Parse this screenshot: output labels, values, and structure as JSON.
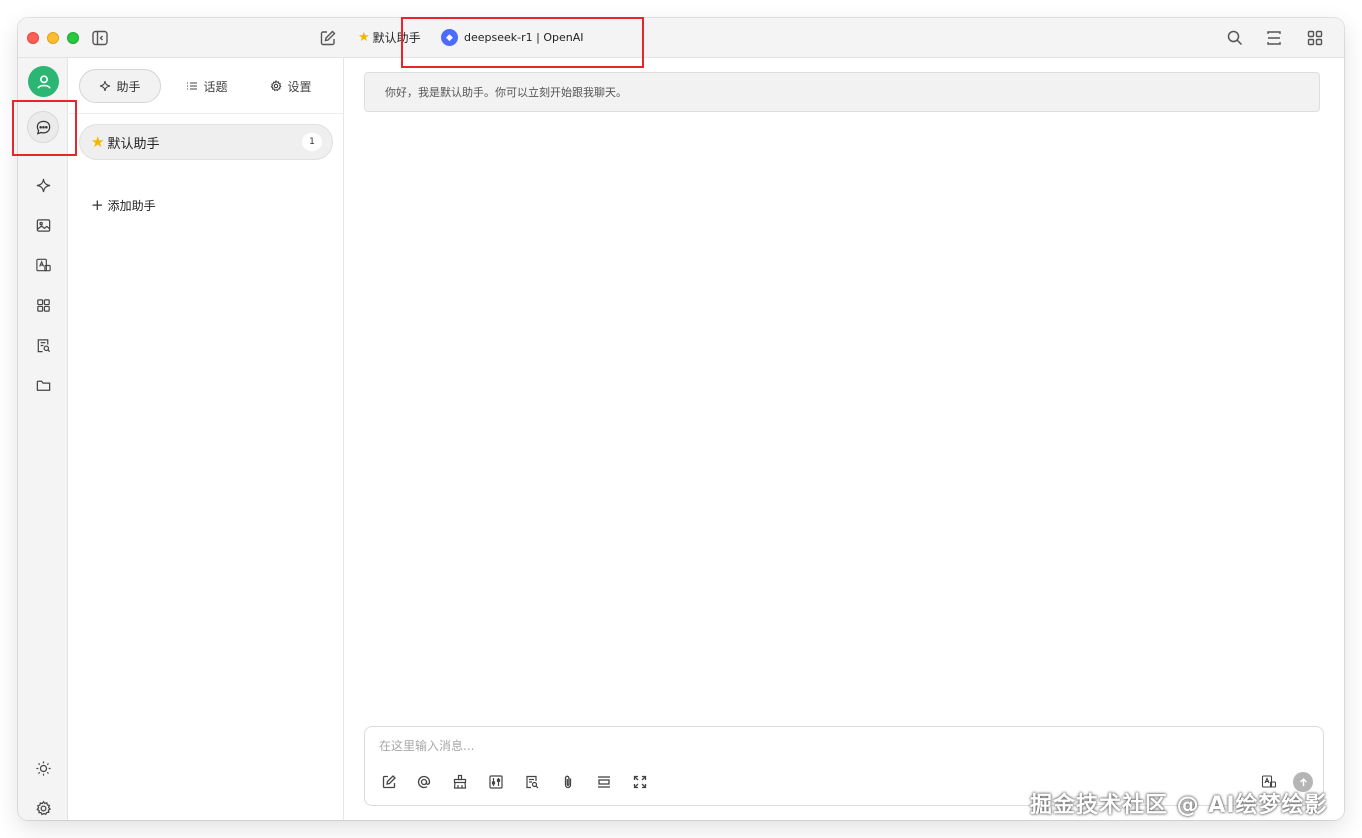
{
  "titlebar": {
    "assistant_name": "默认助手",
    "model_name": "deepseek-r1 | OpenAI"
  },
  "panel": {
    "tabs": [
      {
        "label": "助手",
        "icon": "sparkle-icon",
        "active": true
      },
      {
        "label": "话题",
        "icon": "list-icon",
        "active": false
      },
      {
        "label": "设置",
        "icon": "gear-icon",
        "active": false
      }
    ],
    "assistants": [
      {
        "label": "默认助手",
        "count": "1"
      }
    ],
    "add_label": "添加助手"
  },
  "chat": {
    "welcome": "你好，我是默认助手。你可以立刻开始跟我聊天。",
    "input_placeholder": "在这里输入消息..."
  },
  "watermark": "掘金技术社区 @ AI绘梦绘影",
  "colors": {
    "accent_green": "#2bb673",
    "highlight_red": "#e8262a",
    "deepseek_blue": "#4d6bfe"
  }
}
